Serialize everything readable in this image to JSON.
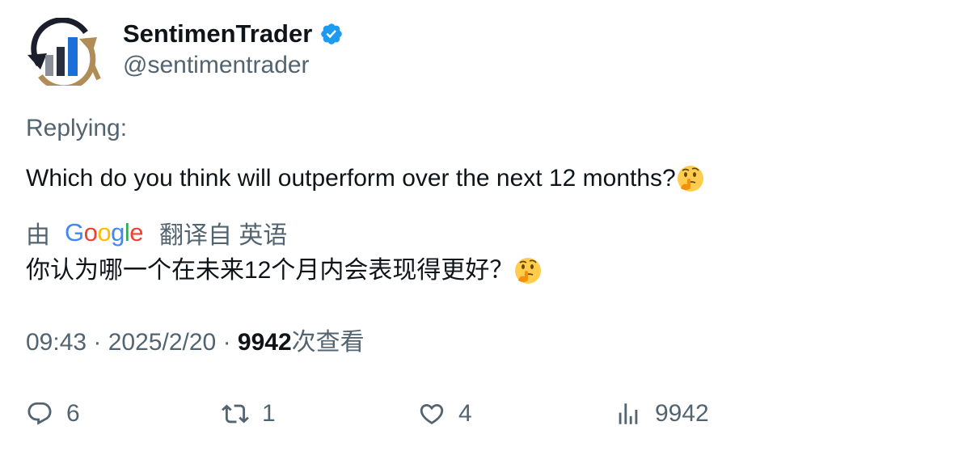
{
  "author": {
    "display_name": "SentimenTrader",
    "handle": "@sentimentrader",
    "verified": true,
    "verified_color": "#1d9bf0"
  },
  "reply_context": {
    "label": "Replying:"
  },
  "tweet": {
    "text": "Which do you think will outperform over the next 12 months?",
    "emoji": "thinking-face"
  },
  "translation": {
    "prefix": "由",
    "provider": "Google",
    "suffix": "翻译自 英语",
    "text": "你认为哪一个在未来12个月内会表现得更好？"
  },
  "meta": {
    "time": "09:43",
    "separator": "·",
    "date": "2025/2/20",
    "views_count": "9942",
    "views_label": "次查看"
  },
  "actions": {
    "reply": {
      "icon": "reply-bubble-icon",
      "count": "6"
    },
    "retweet": {
      "icon": "retweet-icon",
      "count": "1"
    },
    "like": {
      "icon": "heart-icon",
      "count": "4"
    },
    "views": {
      "icon": "bar-chart-icon",
      "count": "9942"
    }
  },
  "colors": {
    "text_primary": "#0f1419",
    "text_secondary": "#536471",
    "google_blue": "#4285f4",
    "google_red": "#ea4335",
    "google_yellow": "#fbbc05",
    "google_green": "#34a853"
  }
}
